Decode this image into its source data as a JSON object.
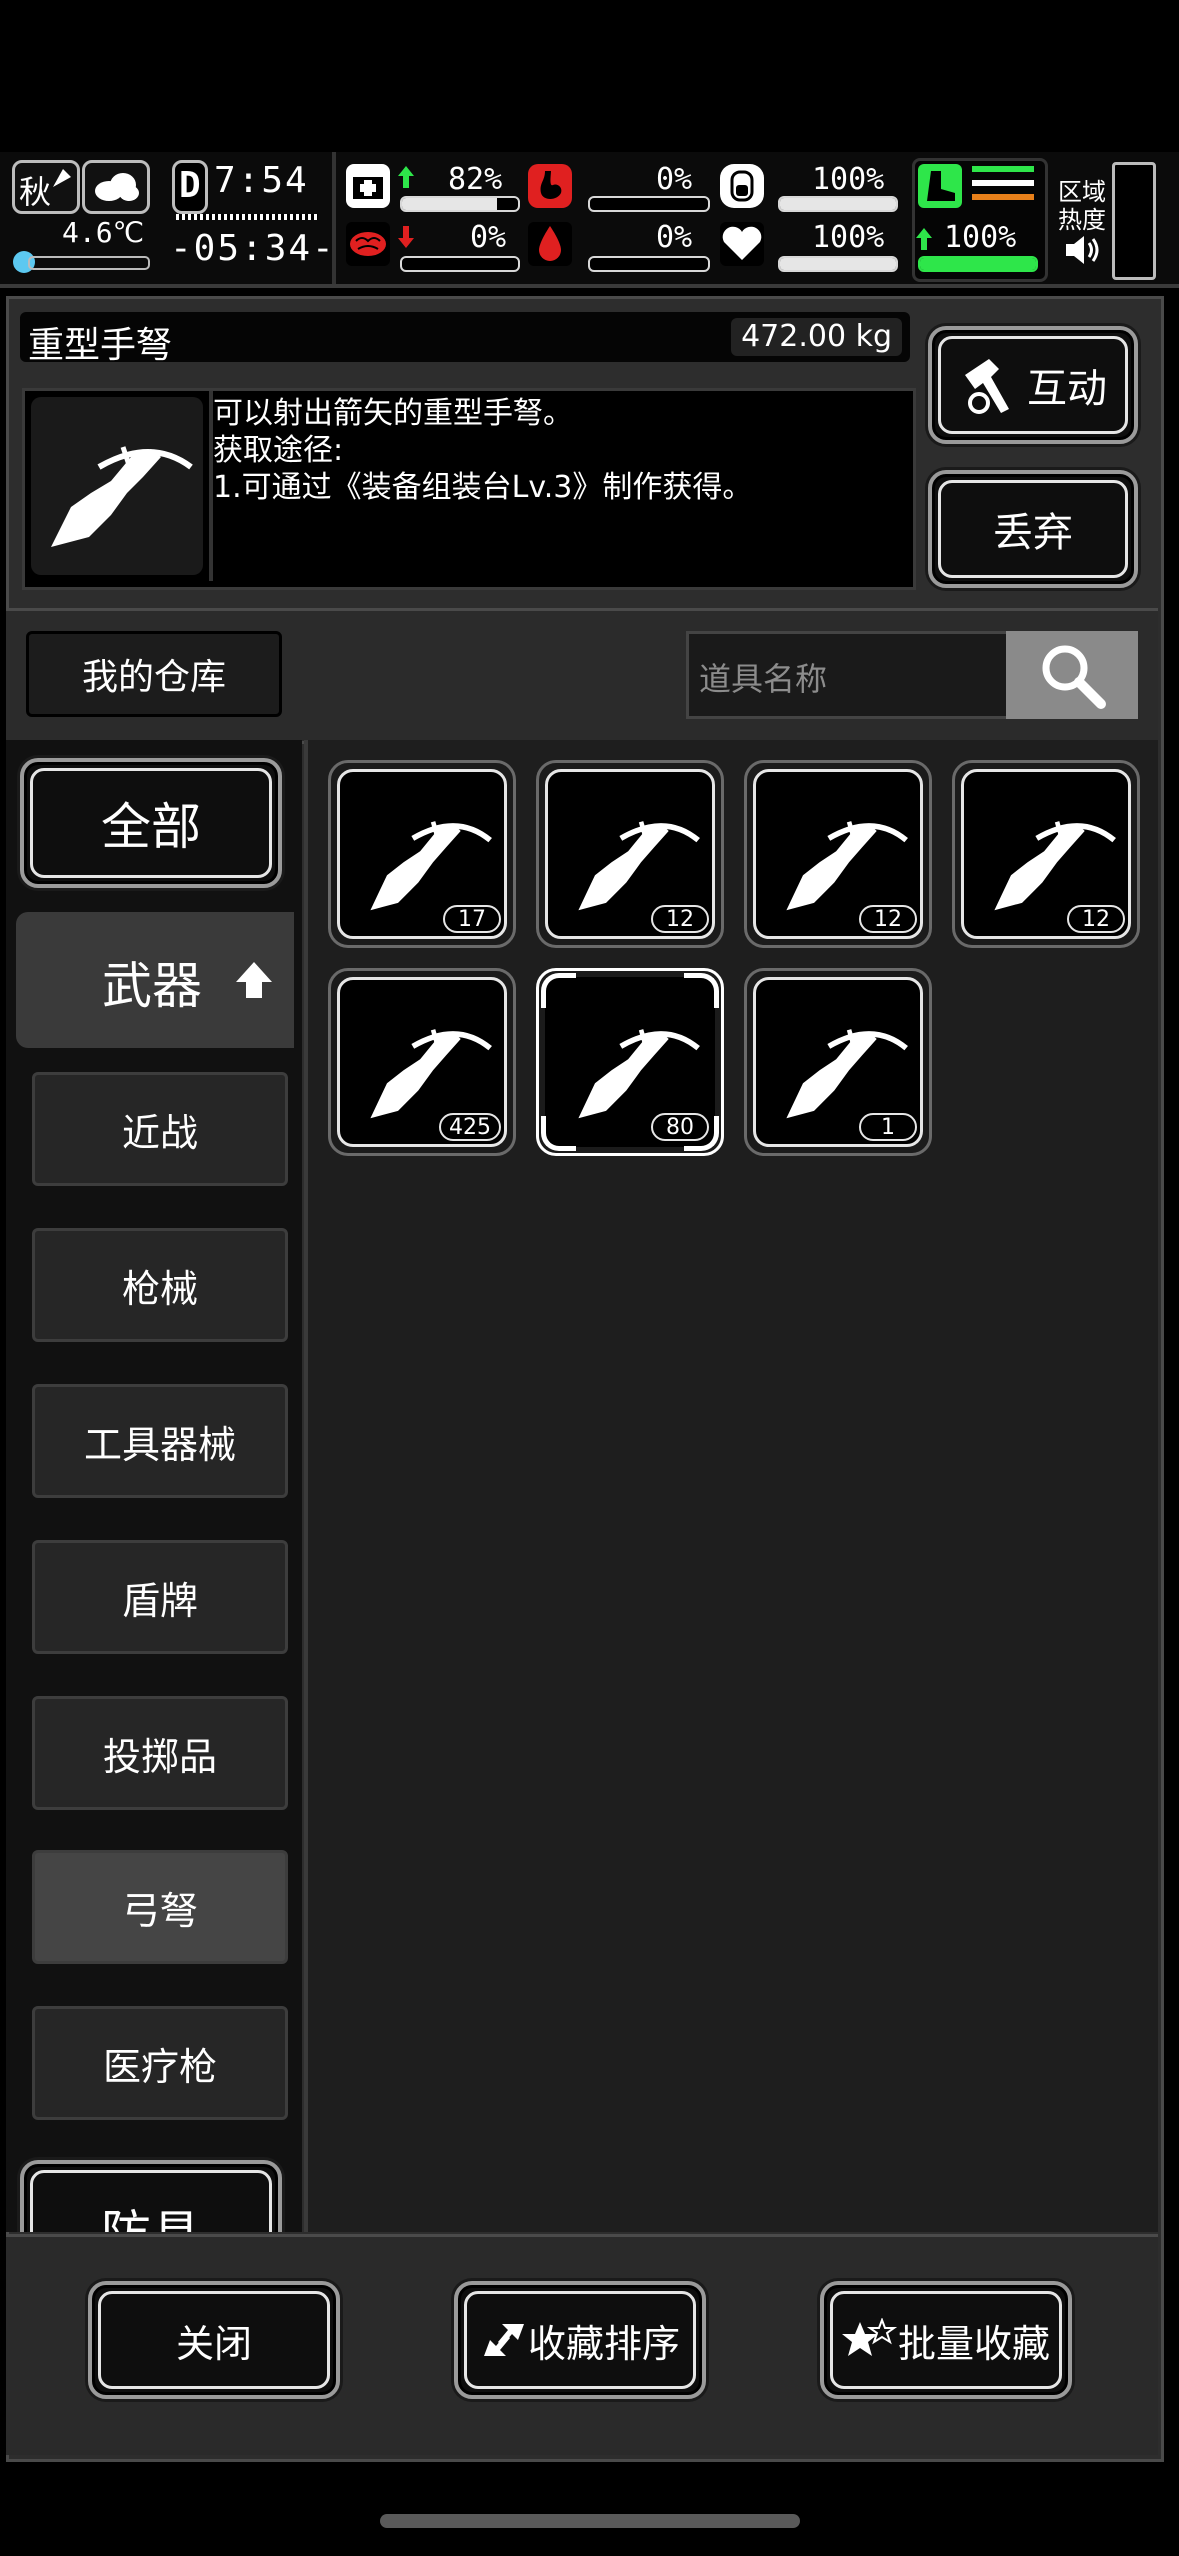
{
  "hud": {
    "season": "秋",
    "temperature": "4.6℃",
    "day_glyph": "D",
    "day_count": "7:54",
    "clock": "-05:34-",
    "stats": [
      {
        "label": "82%",
        "icon": "medkit-icon",
        "trend": "up",
        "level": 0.82
      },
      {
        "label": "0%",
        "icon": "stomach-icon",
        "trend": "none",
        "level": 0.0
      },
      {
        "label": "100%",
        "icon": "bladder-icon",
        "trend": "none",
        "level": 1.0
      },
      {
        "label": "0%",
        "icon": "brain-icon",
        "trend": "down",
        "level": 0.0
      },
      {
        "label": "0%",
        "icon": "blood-drop-icon",
        "trend": "none",
        "level": 0.0
      },
      {
        "label": "100%",
        "icon": "heart-icon",
        "trend": "none",
        "level": 1.0
      }
    ],
    "stamina": "100%",
    "zone_label_1": "区域",
    "zone_label_2": "热度"
  },
  "item": {
    "name": "重型手弩",
    "weight": "472.00 kg",
    "desc_line1": "可以射出箭矢的重型手弩。",
    "desc_line2": "获取途径:",
    "desc_line3": "1.可通过《装备组装台Lv.3》制作获得。"
  },
  "actions": {
    "interact": "互动",
    "discard": "丢弃"
  },
  "storage": {
    "title": "我的仓库",
    "search_placeholder": "道具名称"
  },
  "categories": {
    "all": "全部",
    "weapons": "武器",
    "melee": "近战",
    "firearms": "枪械",
    "tools": "工具器械",
    "shields": "盾牌",
    "throwables": "投掷品",
    "bows": "弓弩",
    "medgun": "医疗枪",
    "armor": "防具"
  },
  "slots": [
    "17",
    "12",
    "12",
    "12",
    "425",
    "80",
    "1"
  ],
  "bottom": {
    "close": "关闭",
    "sort_fav": "收藏排序",
    "batch_fav": "批量收藏"
  },
  "colors": {
    "accent_green": "#2ee64a",
    "danger_red": "#e02020",
    "stamina_orange": "#e8801a"
  }
}
